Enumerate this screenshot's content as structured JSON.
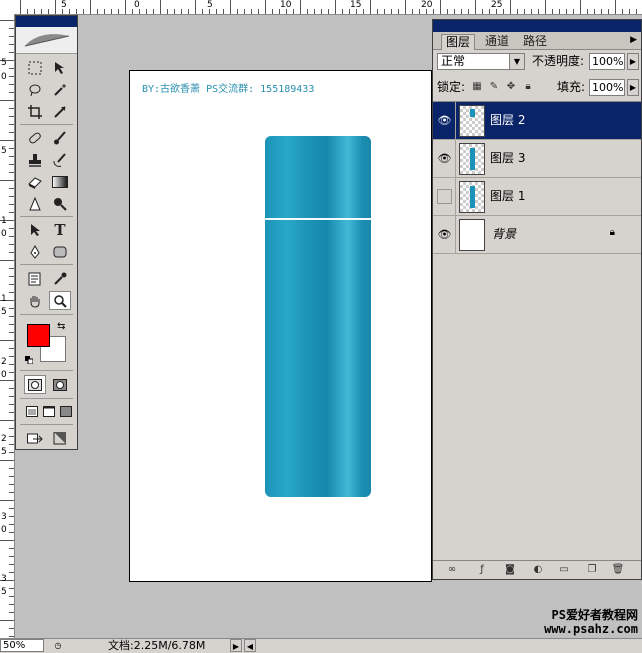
{
  "ruler": {
    "top_labels": [
      "5",
      "0",
      "5",
      "10",
      "15",
      "20",
      "25"
    ],
    "left_labels": [
      "5",
      "0",
      "5",
      "1",
      "0",
      "1",
      "5",
      "2",
      "0",
      "2",
      "5",
      "3",
      "0",
      "3",
      "5"
    ]
  },
  "document": {
    "watermark": "BY:古欲香萧 PS交流群: 155189433",
    "bottle_color": "#1b93b8"
  },
  "toolbox": {
    "foreground_color": "#ff0000",
    "background_color": "#ffffff",
    "tools": [
      "marquee-icon",
      "move-icon",
      "lasso-icon",
      "magic-wand-icon",
      "crop-icon",
      "slice-icon",
      "healing-icon",
      "brush-icon",
      "stamp-icon",
      "history-brush-icon",
      "eraser-icon",
      "gradient-icon",
      "blur-icon",
      "dodge-icon",
      "path-select-icon",
      "type-icon",
      "pen-icon",
      "shape-icon",
      "notes-icon",
      "eyedropper-icon",
      "hand-icon",
      "zoom-icon"
    ],
    "type_glyph": "T"
  },
  "layers_panel": {
    "tabs": [
      "图层",
      "通道",
      "路径"
    ],
    "active_tab": "图层",
    "blend_mode": "正常",
    "opacity_label": "不透明度:",
    "opacity_value": "100%",
    "lock_label": "锁定:",
    "fill_label": "填充:",
    "fill_value": "100%",
    "layers": [
      {
        "name": "图层 2",
        "visible": true,
        "selected": true
      },
      {
        "name": "图层 3",
        "visible": true,
        "selected": false
      },
      {
        "name": "图层 1",
        "visible": false,
        "selected": false
      },
      {
        "name": "背景",
        "visible": true,
        "selected": false,
        "locked": true
      }
    ]
  },
  "status_bar": {
    "zoom": "50%",
    "doc_info": "文档:2.25M/6.78M"
  },
  "credit": {
    "line1": "PS爱好者教程网",
    "line2": "www.psahz.com"
  }
}
